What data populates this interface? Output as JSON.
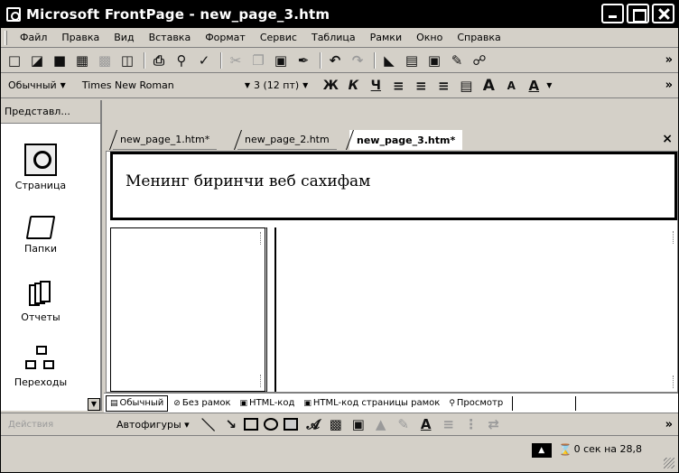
{
  "window": {
    "title": "Microsoft FrontPage - new_page_3.htm"
  },
  "menubar": {
    "items": [
      "Файл",
      "Правка",
      "Вид",
      "Вставка",
      "Формат",
      "Сервис",
      "Таблица",
      "Рамки",
      "Окно",
      "Справка"
    ]
  },
  "format_toolbar": {
    "style": "Обычный",
    "font": "Times New Roman",
    "size": "3 (12 пт)",
    "bold": "Ж",
    "italic": "К",
    "underline": "Ч",
    "grow_font": "A",
    "shrink_font": "A",
    "font_color": "A"
  },
  "views_bar": {
    "header": "Представл...",
    "items": [
      "Страница",
      "Папки",
      "Отчеты",
      "Переходы"
    ]
  },
  "tabs": [
    "new_page_1.htm*",
    "new_page_2.htm",
    "new_page_3.htm*"
  ],
  "editor": {
    "banner_text": "Менинг биринчи веб сахифам"
  },
  "view_tabs": [
    "Обычный",
    "Без рамок",
    "HTML-код",
    "HTML-код страницы рамок",
    "Просмотр"
  ],
  "drawing_toolbar": {
    "draw_label": "Действия",
    "autoshapes": "Автофигуры",
    "font_color": "A"
  },
  "statusbar": {
    "load_time": "0 сек на 28,8"
  }
}
